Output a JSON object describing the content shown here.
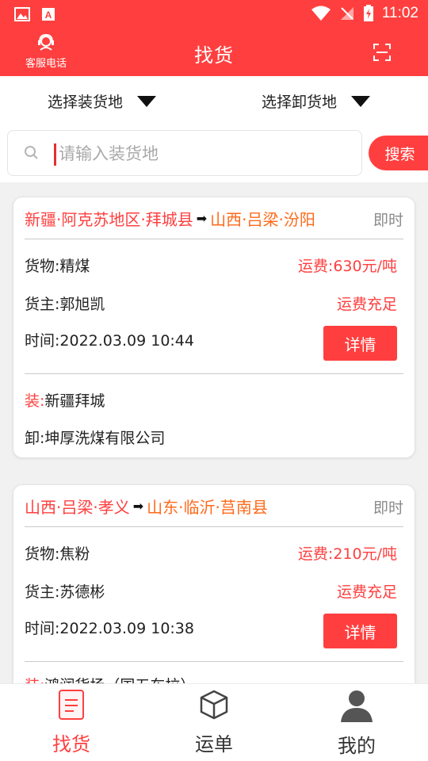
{
  "status_bar": {
    "time": "11:02"
  },
  "header": {
    "customer_service_label": "客服电话",
    "title": "找货"
  },
  "filters": {
    "loading_place": "选择装货地",
    "unloading_place": "选择卸货地"
  },
  "search": {
    "placeholder": "请输入装货地",
    "button_label": "搜索"
  },
  "cards": [
    {
      "from": "新疆·阿克苏地区·拜城县",
      "arrow": "➡",
      "to": "山西·吕梁·汾阳",
      "tag": "即时",
      "cargo": "货物:精煤",
      "freight": "运费:630元/吨",
      "shipper": "货主:郭旭凯",
      "status": "运费充足",
      "time": "时间:2022.03.09 10:44",
      "detail_label": "详情",
      "load_prefix": "装:",
      "load_place": "新疆拜城",
      "unload": "卸:坤厚洗煤有限公司"
    },
    {
      "from": "山西·吕梁·孝义",
      "arrow": "➡",
      "to": "山东·临沂·莒南县",
      "tag": "即时",
      "cargo": "货物:焦粉",
      "freight": "运费:210元/吨",
      "shipper": "货主:苏德彬",
      "status": "运费充足",
      "time": "时间:2022.03.09 10:38",
      "detail_label": "详情",
      "load_prefix": "装:",
      "load_place": "鸿润货场（国五车拉）",
      "unload": ""
    }
  ],
  "tabs": [
    {
      "label": "找货",
      "icon": "document-icon",
      "active": true
    },
    {
      "label": "运单",
      "icon": "box-icon",
      "active": false
    },
    {
      "label": "我的",
      "icon": "user-icon",
      "active": false
    }
  ],
  "colors": {
    "primary": "#ff3f3f",
    "destination": "#ff6a1a"
  }
}
